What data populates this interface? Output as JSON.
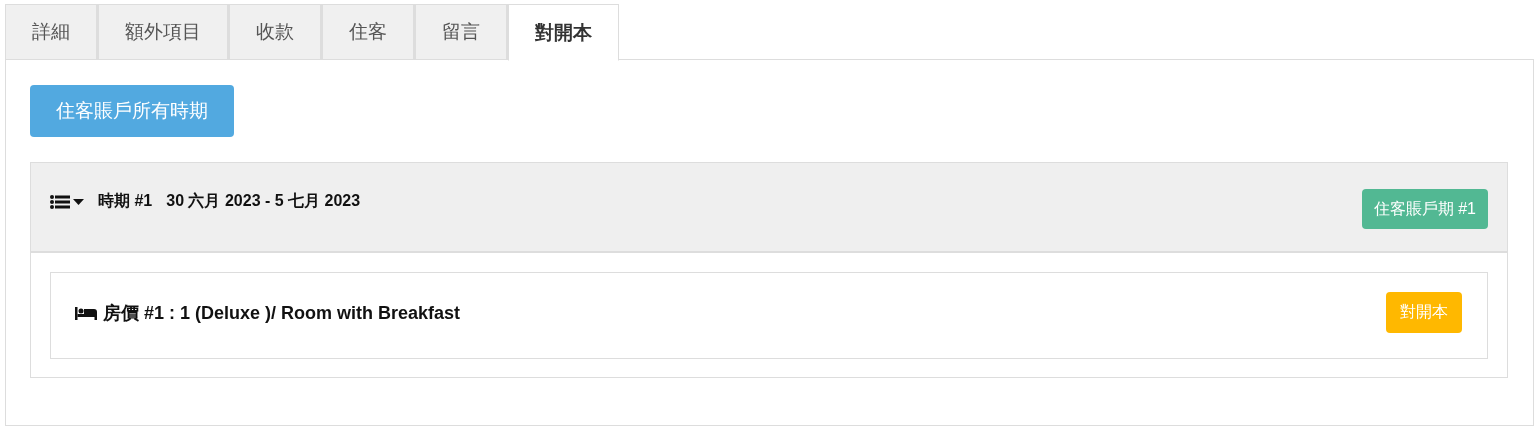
{
  "tabs": [
    {
      "label": "詳細",
      "selected": false
    },
    {
      "label": "額外項目",
      "selected": false
    },
    {
      "label": "收款",
      "selected": false
    },
    {
      "label": "住客",
      "selected": false
    },
    {
      "label": "留言",
      "selected": false
    },
    {
      "label": "對開本",
      "selected": true
    }
  ],
  "all_periods_button": "住客賬戶所有時期",
  "period": {
    "label": "時期 #1",
    "dates": "30 六月 2023 - 5 七月 2023",
    "badge": "住客賬戶期 #1",
    "rates": [
      {
        "label": "房價 #1 : 1 (Deluxe )/ Room with Breakfast",
        "button": "對開本"
      }
    ]
  }
}
